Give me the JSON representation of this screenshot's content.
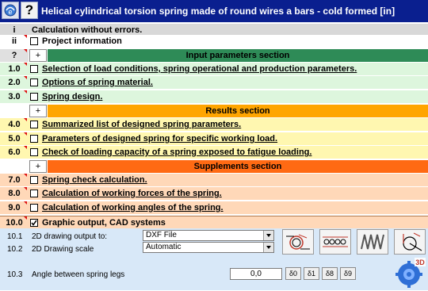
{
  "window": {
    "title": "Helical cylindrical torsion spring made of round wires a bars - cold formed [in]"
  },
  "toolbar": {
    "help_glyph": "?"
  },
  "rows": [
    {
      "idx": "i",
      "label": "Calculation without errors.",
      "has_check": false,
      "bg": "#d8d8d8"
    },
    {
      "idx": "ii",
      "label": "Project information",
      "has_check": true,
      "bg": "#ffffff"
    },
    {
      "idx": "1.0",
      "label": "Selection of load conditions, spring operational and production parameters.",
      "has_check": true,
      "bg": "#ddf6dd"
    },
    {
      "idx": "2.0",
      "label": "Options of spring material.",
      "has_check": true,
      "bg": "#ddf6dd"
    },
    {
      "idx": "3.0",
      "label": "Spring design.",
      "has_check": true,
      "bg": "#ddf6dd"
    },
    {
      "idx": "4.0",
      "label": "Summarized list of designed spring parameters.",
      "has_check": true,
      "bg": "#fff7b0"
    },
    {
      "idx": "5.0",
      "label": "Parameters of designed spring for specific working load.",
      "has_check": true,
      "bg": "#fff7b0"
    },
    {
      "idx": "6.0",
      "label": "Check of loading capacity of a spring exposed to fatigue loading.",
      "has_check": true,
      "bg": "#fff7b0"
    },
    {
      "idx": "7.0",
      "label": "Spring check calculation.",
      "has_check": true,
      "bg": "#ffd8b8"
    },
    {
      "idx": "8.0",
      "label": "Calculation of working forces of the spring.",
      "has_check": true,
      "bg": "#ffd8b8"
    },
    {
      "idx": "9.0",
      "label": "Calculation of working angles of the spring.",
      "has_check": true,
      "bg": "#ffd8b8"
    },
    {
      "idx": "10.0",
      "label": "Graphic output, CAD systems",
      "has_check": true,
      "checked": true,
      "bg": "#ffd8b8"
    }
  ],
  "sections": {
    "input": {
      "idx": "?",
      "plus": "+",
      "title": "Input parameters section",
      "color": "#2e8b57"
    },
    "results": {
      "plus": "+",
      "title": "Results section",
      "color": "#ffa500"
    },
    "supplements": {
      "plus": "+",
      "title": "Supplements section",
      "color": "#ff6a13"
    }
  },
  "graphic": {
    "r1_num": "10.1",
    "r1_label": "2D drawing output to:",
    "r1_value": "DXF File",
    "r2_num": "10.2",
    "r2_label": "2D Drawing scale",
    "r2_value": "Automatic",
    "r3_num": "10.3",
    "r3_label": "Angle between spring legs",
    "r3_value": "0,0",
    "angle_buttons": [
      "δ0",
      "δ1",
      "δ8",
      "δ9"
    ],
    "cad_badge": "3D"
  }
}
